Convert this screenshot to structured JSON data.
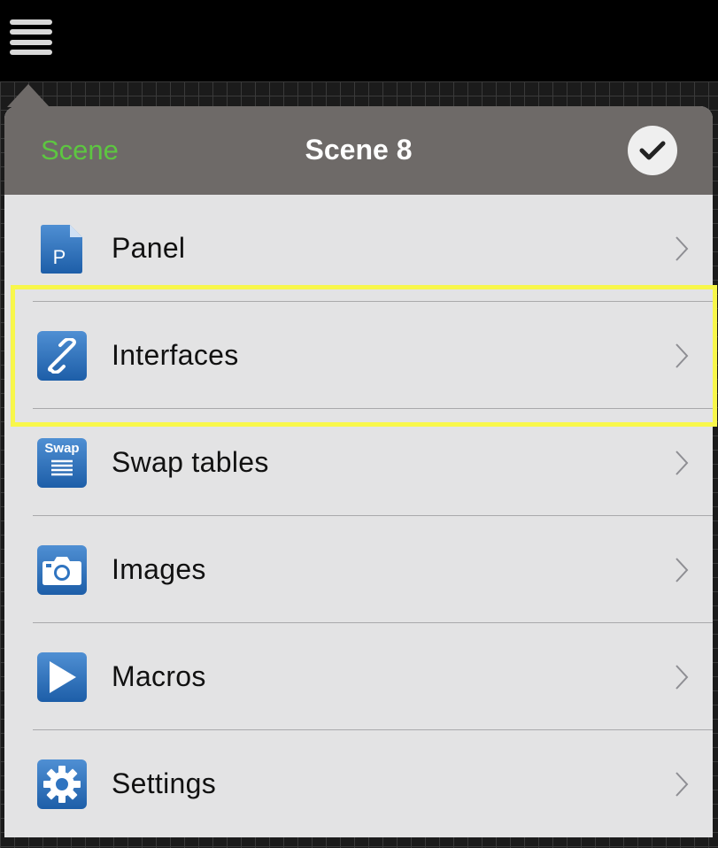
{
  "header": {
    "back_label": "Scene",
    "title": "Scene 8",
    "done_icon": "checkmark-icon"
  },
  "menu_icon": "hamburger-menu-icon",
  "menu": {
    "items": [
      {
        "label": "Panel",
        "icon": "panel-document-icon",
        "icon_text": "P"
      },
      {
        "label": "Interfaces",
        "icon": "link-icon",
        "highlighted": true
      },
      {
        "label": "Swap tables",
        "icon": "swap-table-icon",
        "icon_text": "Swap"
      },
      {
        "label": "Images",
        "icon": "camera-icon"
      },
      {
        "label": "Macros",
        "icon": "play-icon"
      },
      {
        "label": "Settings",
        "icon": "gear-icon"
      }
    ]
  },
  "colors": {
    "accent": "#5dc641",
    "header_bg": "#6e6a68",
    "list_bg": "#e3e3e4",
    "highlight": "#f8f74a",
    "icon_blue": "#2f74c0"
  }
}
